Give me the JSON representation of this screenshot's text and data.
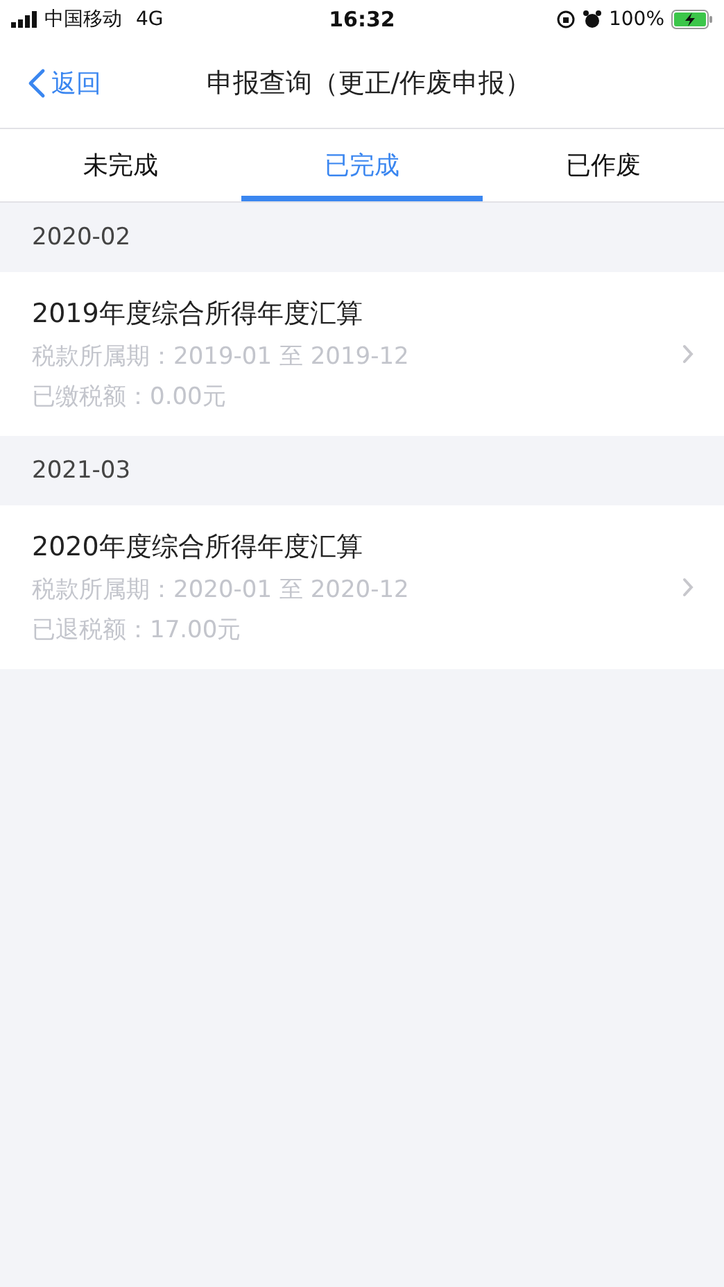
{
  "status_bar": {
    "carrier": "中国移动",
    "network": "4G",
    "time": "16:32",
    "battery": "100%"
  },
  "nav_bar": {
    "back": "返回",
    "title": "申报查询（更正/作废申报）"
  },
  "tabs": [
    {
      "label": "未完成",
      "selected": false
    },
    {
      "label": "已完成",
      "selected": true
    },
    {
      "label": "已作废",
      "selected": false
    }
  ],
  "groups": [
    {
      "header": "2020-02",
      "items": [
        {
          "title": "2019年度综合所得年度汇算",
          "period": "税款所属期：2019-01 至 2019-12",
          "amount": "已缴税额：0.00元"
        }
      ]
    },
    {
      "header": "2021-03",
      "items": [
        {
          "title": "2020年度综合所得年度汇算",
          "period": "税款所属期：2020-01 至 2020-12",
          "amount": "已退税额：17.00元"
        }
      ]
    }
  ]
}
